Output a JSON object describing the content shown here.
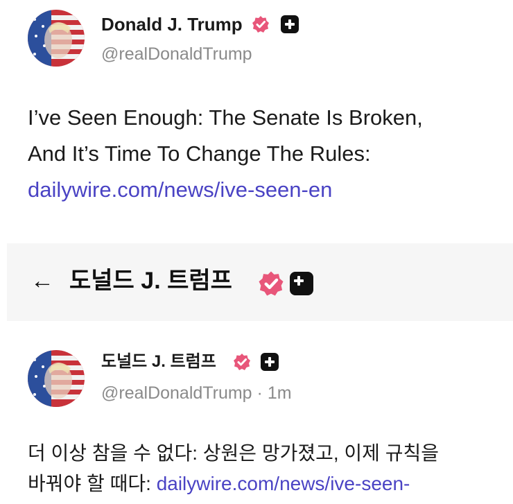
{
  "top_post": {
    "author_name": "Donald J. Trump",
    "handle": "@realDonaldTrump",
    "text_line1": "I’ve Seen Enough: The Senate Is Broken,",
    "text_line2": "And It’s Time To Change The Rules:",
    "link": "dailywire.com/news/ive-seen-en"
  },
  "header": {
    "back_icon": "←",
    "title": "도널드 J. 트럼프"
  },
  "bottom_post": {
    "author_name": "도널드 J. 트럼프",
    "handle": "@realDonaldTrump",
    "time": "· 1m",
    "text_line1": "더 이상 참을 수 없다: 상원은 망가졌고, 이제 규칙을",
    "text_line2_prefix": "바꿔야 할 때다: ",
    "link": "dailywire.com/news/ive-seen-"
  },
  "colors": {
    "verified_badge": "#e8567a",
    "link": "#4a43c4",
    "header_bg": "#f6f6f6"
  },
  "icons": {
    "verified": "verified-badge-icon",
    "plus": "plus-icon",
    "back": "back-arrow-icon"
  }
}
